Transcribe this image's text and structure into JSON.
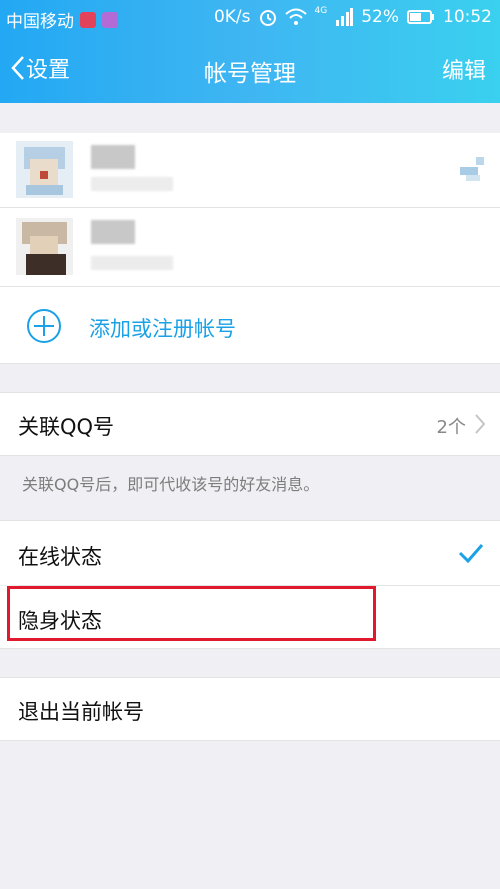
{
  "status_bar": {
    "carrier": "中国移动",
    "speed": "0K/s",
    "network": "4G",
    "battery": "52%",
    "time": "10:52"
  },
  "nav": {
    "back_label": "设置",
    "title": "帐号管理",
    "edit_label": "编辑"
  },
  "accounts": {
    "add_label": "添加或注册帐号"
  },
  "linked_qq": {
    "label": "关联QQ号",
    "count": "2个",
    "hint": "关联QQ号后，即可代收该号的好友消息。"
  },
  "status_options": {
    "online": "在线状态",
    "invisible": "隐身状态"
  },
  "logout": {
    "label": "退出当前帐号"
  },
  "colors": {
    "accent": "#1aa1e7",
    "highlight_border": "#e0192d"
  }
}
